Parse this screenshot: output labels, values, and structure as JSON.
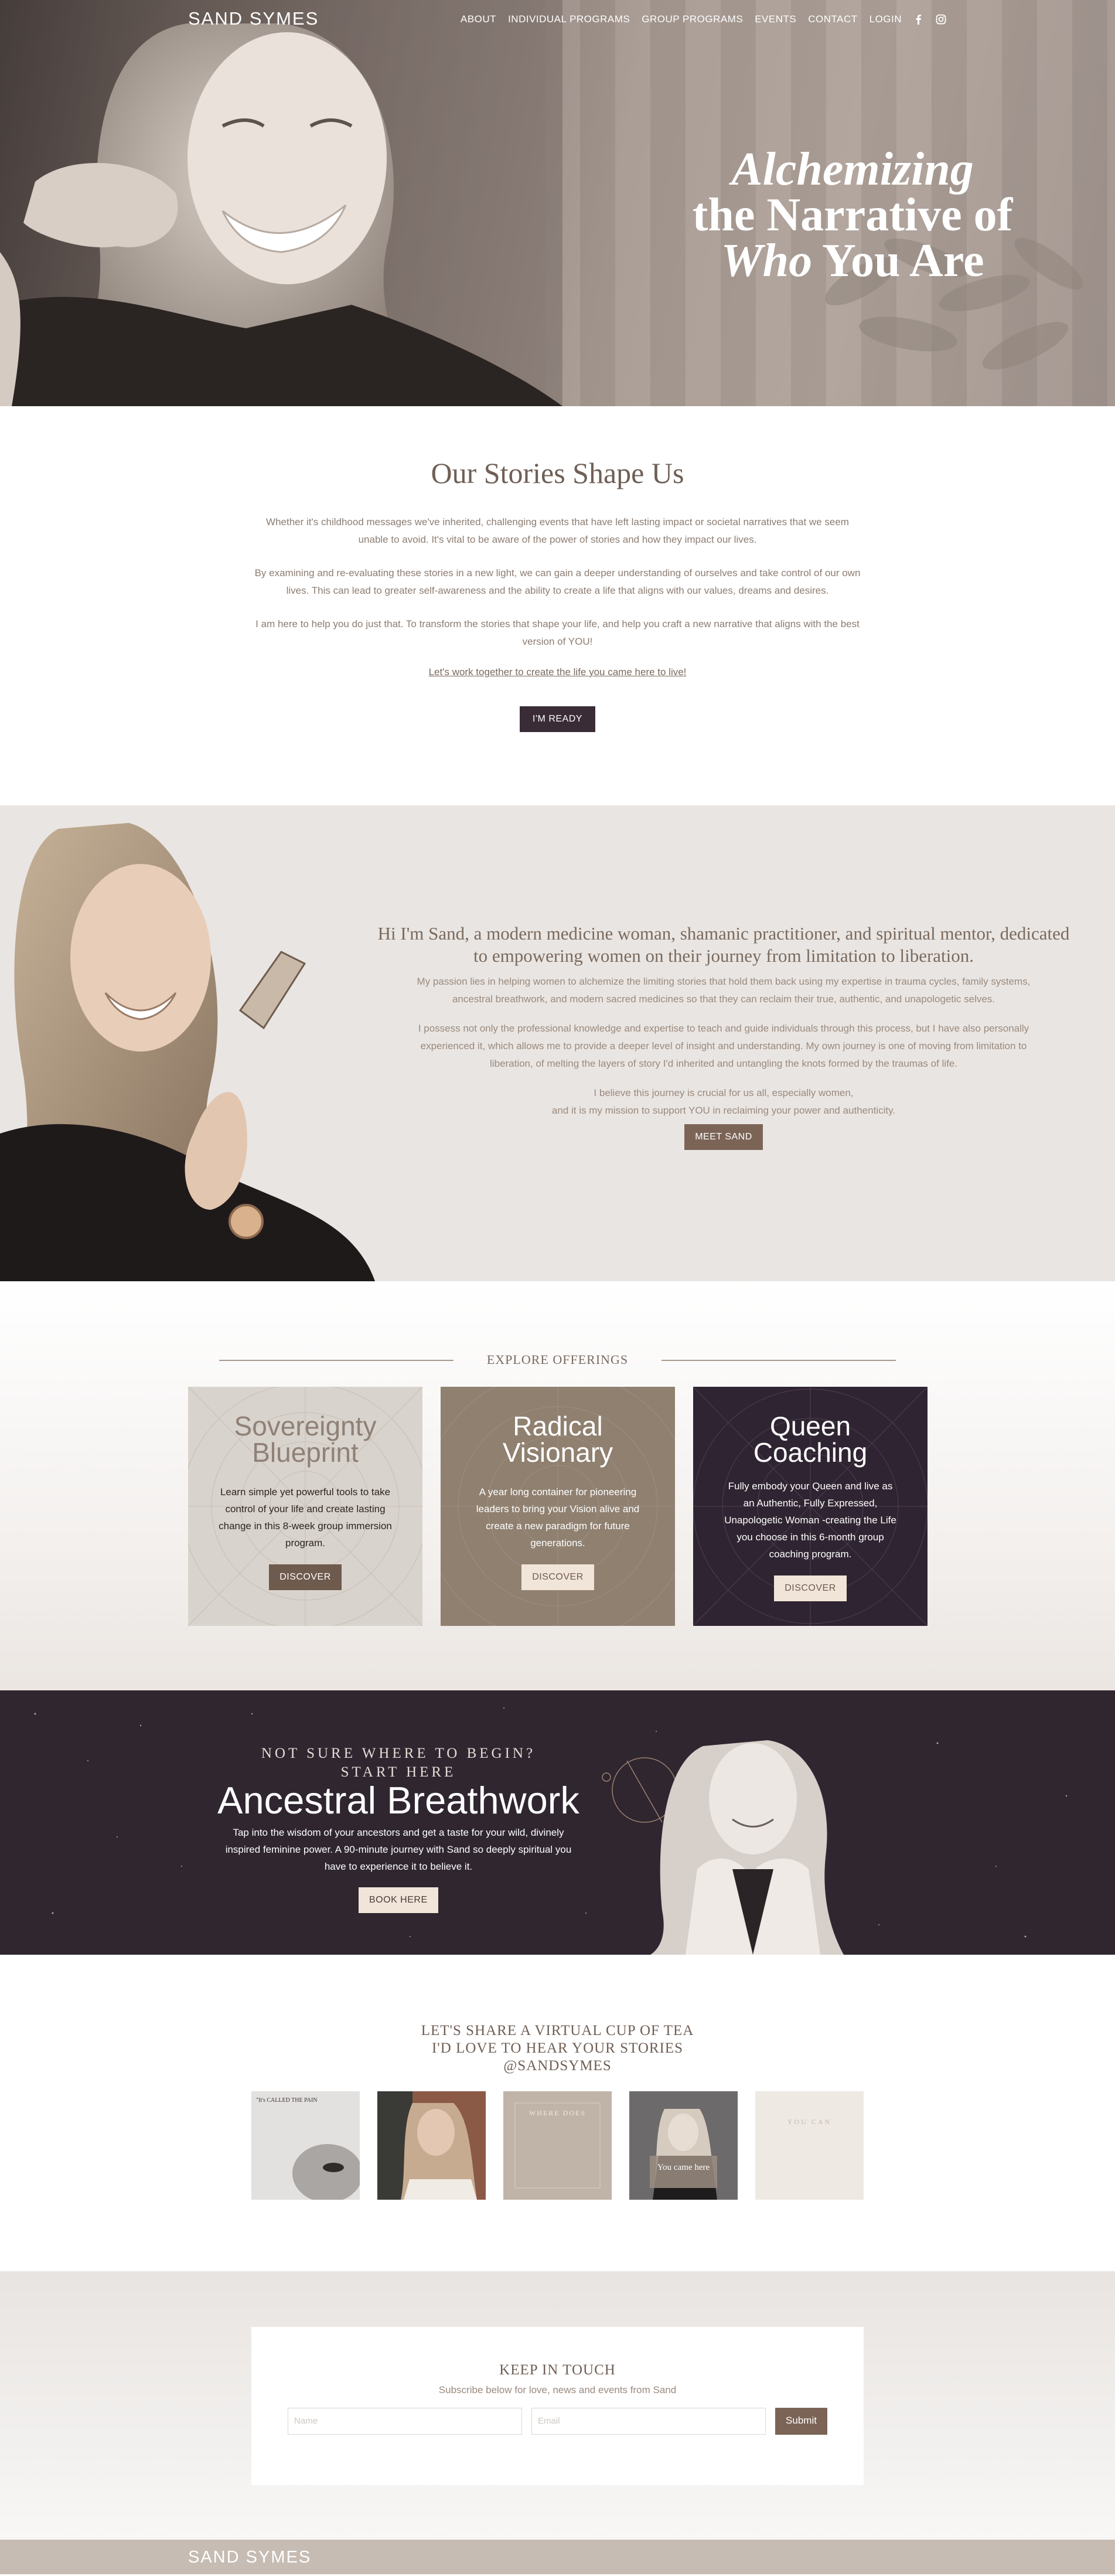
{
  "nav": {
    "brand": "SAND SYMES",
    "links": [
      "ABOUT",
      "INDIVIDUAL PROGRAMS",
      "GROUP PROGRAMS",
      "EVENTS",
      "CONTACT",
      "LOGIN"
    ],
    "icons": [
      "facebook-icon",
      "instagram-icon"
    ]
  },
  "hero": {
    "line1": "Alchemizing",
    "line2": "the Narrative of",
    "line3a": "Who",
    "line3b": " You Are"
  },
  "stories": {
    "title": "Our Stories Shape Us",
    "p1": "Whether it's childhood messages we've inherited, challenging events that have left lasting impact or societal narratives that we seem unable to avoid. It's vital to be aware of the power of stories and how they impact our lives.",
    "p2": "By examining and re-evaluating these stories in a new light, we can gain a deeper understanding of ourselves and take control of our own lives. This can lead to greater self-awareness and the ability to create a life that aligns with our values, dreams and desires.",
    "p3": "I am here to help you do just that. To transform the stories that shape your life, and help you craft a new narrative that aligns with the best version of YOU!",
    "link": "Let's work together to create the life you came here to live!",
    "button": "I'M READY"
  },
  "about": {
    "heading": "Hi I'm Sand, a modern medicine woman, shamanic practitioner, and spiritual mentor, dedicated to empowering women on their journey from limitation to liberation.",
    "p1": "My passion lies in helping women to alchemize the limiting stories that hold them back using my expertise in trauma cycles, family systems, ancestral breathwork, and modern sacred medicines so that they can reclaim their true, authentic, and unapologetic selves.",
    "p2": "I possess not only the professional knowledge and expertise to teach and guide individuals through this process, but I have also personally experienced it, which allows me to provide a deeper level of insight and understanding. My own journey is one of moving from limitation to liberation, of melting the layers of story I'd inherited and untangling the knots formed by the traumas of life.",
    "p3a": "I believe this journey is crucial for us all, especially women,",
    "p3b": "and it is my mission to support YOU in reclaiming your power and authenticity.",
    "button": "MEET SAND"
  },
  "offerings": {
    "label": "EXPLORE OFFERINGS",
    "cards": [
      {
        "title1": "Sovereignty",
        "title2": "Blueprint",
        "desc": "Learn simple yet powerful tools to take control of your life and create lasting change in this 8-week group immersion program.",
        "button": "DISCOVER"
      },
      {
        "title1": "Radical",
        "title2": "Visionary",
        "desc": "A year long container for pioneering leaders to bring your Vision alive and create a new paradigm for future generations.",
        "button": "DISCOVER"
      },
      {
        "title1": "Queen",
        "title2": "Coaching",
        "desc": "Fully embody your Queen and live as an Authentic, Fully Expressed, Unapologetic Woman -creating the Life you choose in this 6-month group coaching program.",
        "button": "DISCOVER"
      }
    ]
  },
  "breathwork": {
    "pre1": "NOT SURE WHERE TO BEGIN?",
    "pre2": "START HERE",
    "title": "Ancestral Breathwork",
    "desc": "Tap into the wisdom of your ancestors and get a taste for your wild, divinely inspired feminine power. A 90-minute journey with Sand so deeply spiritual you have to experience it to believe it.",
    "button": "BOOK HERE"
  },
  "instagram": {
    "line1": "LET'S SHARE A VIRTUAL CUP OF TEA",
    "line2": "I'D LOVE TO HEAR YOUR STORIES",
    "line3": "@SANDSYMES",
    "tiles": [
      {
        "caption": "\"It's CALLED THE PAIN"
      },
      {
        "caption": ""
      },
      {
        "caption": "WHERE DOES"
      },
      {
        "caption": "You came here"
      },
      {
        "caption": "YOU CAN"
      }
    ]
  },
  "touch": {
    "title": "KEEP IN TOUCH",
    "subtitle": "Subscribe below for love, news and events from Sand",
    "name_placeholder": "Name",
    "email_placeholder": "Email",
    "button": "Submit"
  },
  "footer": {
    "brand": "SAND SYMES"
  }
}
